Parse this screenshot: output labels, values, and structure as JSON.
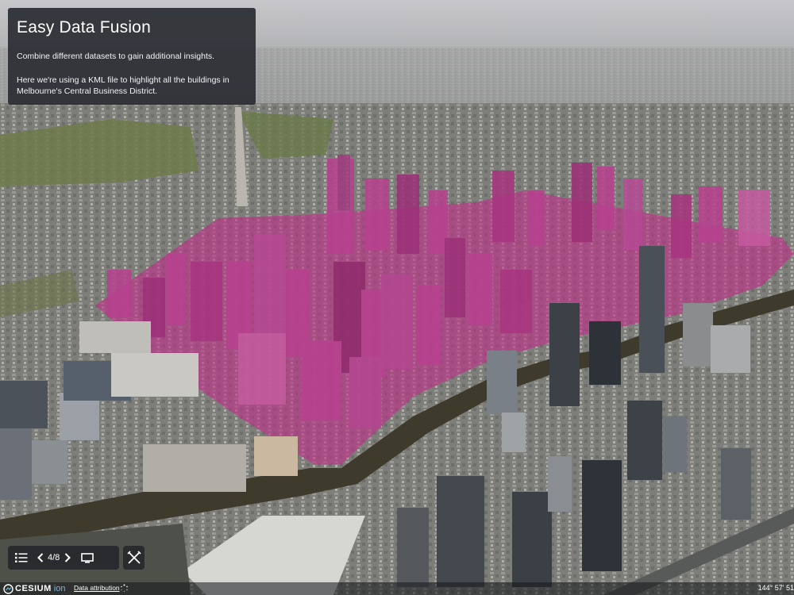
{
  "info_panel": {
    "title": "Easy Data Fusion",
    "paragraph1": "Combine different datasets to gain additional insights.",
    "paragraph2": "Here we're using a KML file to highlight all the buildings in Melbourne's Central Business District."
  },
  "story_controls": {
    "menu_icon": "list-icon",
    "prev_icon": "chevron-left-icon",
    "page": "4/8",
    "next_icon": "chevron-right-icon",
    "screen_icon": "monitor-icon",
    "tools_icon": "crossed-tools-icon"
  },
  "credits": {
    "logo_text": "CESIUM",
    "logo_suffix": "ion",
    "attribution": "Data attribution",
    "coordinates": "144° 57' 51"
  },
  "colors": {
    "highlight": "#c0308a",
    "panel": "#2a2d33",
    "ion_accent": "#6fb8e8"
  }
}
